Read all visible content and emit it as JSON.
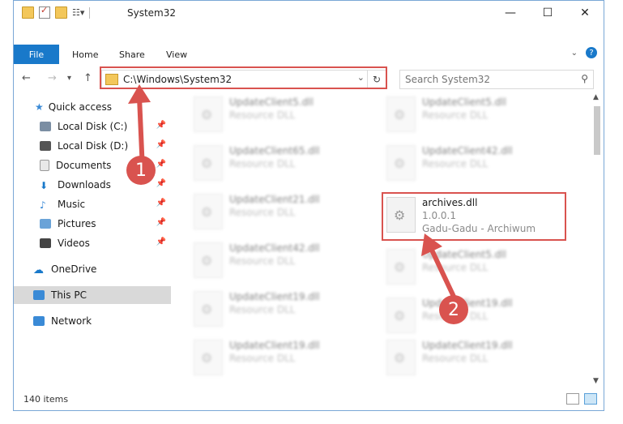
{
  "window": {
    "title": "System32"
  },
  "ribbon": {
    "file": "File",
    "home": "Home",
    "share": "Share",
    "view": "View"
  },
  "address": {
    "path": "C:\\Windows\\System32"
  },
  "search": {
    "placeholder": "Search System32"
  },
  "nav": {
    "quick_access": "Quick access",
    "items": [
      {
        "label": "Local Disk (C:)",
        "icon": "disk-icon"
      },
      {
        "label": "Local Disk (D:)",
        "icon": "disk-icon"
      },
      {
        "label": "Documents",
        "icon": "documents-icon"
      },
      {
        "label": "Downloads",
        "icon": "downloads-icon"
      },
      {
        "label": "Music",
        "icon": "music-icon"
      },
      {
        "label": "Pictures",
        "icon": "pictures-icon"
      },
      {
        "label": "Videos",
        "icon": "videos-icon"
      }
    ],
    "onedrive": "OneDrive",
    "this_pc": "This PC",
    "network": "Network"
  },
  "files": {
    "left": [
      {
        "name": "UpdateClient5.dll",
        "desc": "Resource DLL"
      },
      {
        "name": "UpdateClient65.dll",
        "desc": "Resource DLL"
      },
      {
        "name": "UpdateClient21.dll",
        "desc": "Resource DLL"
      },
      {
        "name": "UpdateClient42.dll",
        "desc": "Resource DLL"
      },
      {
        "name": "UpdateClient19.dll",
        "desc": "Resource DLL"
      },
      {
        "name": "UpdateClient19.dll",
        "desc": "Resource DLL"
      }
    ],
    "right": [
      {
        "name": "UpdateClient5.dll",
        "desc": "Resource DLL"
      },
      {
        "name": "UpdateClient42.dll",
        "desc": "Resource DLL"
      },
      {
        "name": "UpdateClient5.dll",
        "desc": "Resource DLL"
      },
      {
        "name": "UpdateClient19.dll",
        "desc": "Resource DLL"
      },
      {
        "name": "UpdateClient19.dll",
        "desc": "Resource DLL"
      }
    ],
    "highlight": {
      "name": "archives.dll",
      "version": "1.0.0.1",
      "desc": "Gadu-Gadu - Archiwum"
    }
  },
  "status": {
    "count": "140 items"
  },
  "annotations": {
    "one": "1",
    "two": "2"
  }
}
